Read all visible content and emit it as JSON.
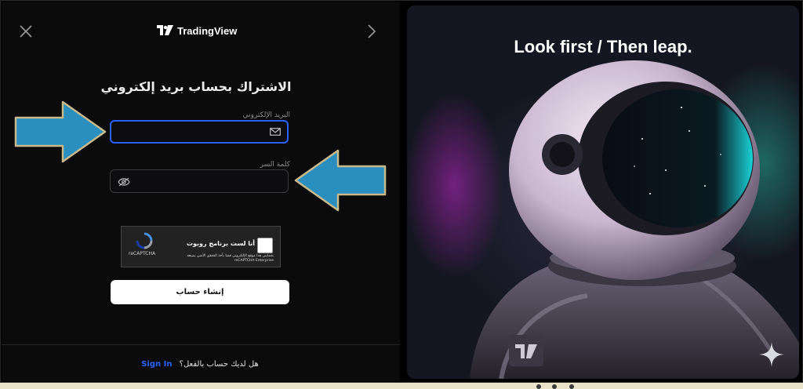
{
  "header": {
    "brand": "TradingView"
  },
  "form": {
    "title": "الاشتراك بحساب بريد إلكتروني",
    "email": {
      "label": "البريد الإلكتروني",
      "value": "",
      "placeholder": ""
    },
    "password": {
      "label": "كلمة السر",
      "value": "",
      "placeholder": ""
    },
    "submit_label": "إنشاء حساب"
  },
  "captcha": {
    "checkbox_text": "أنا لست برنامج روبوت",
    "note": "بحمايتي هذا موقع الإلكتروني قمنا بأخذ التحقق الأمني بصيغة reCAPTCHA Enterprise",
    "brand": "reCAPTCHA"
  },
  "footer": {
    "question": "هل لديك حساب بالفعل؟",
    "signin_label": "Sign In"
  },
  "promo": {
    "tagline": "Look first / Then leap."
  },
  "colors": {
    "accent": "#2962ff",
    "arrow": "#2a8fbf",
    "arrow_border": "#c8b98a"
  }
}
